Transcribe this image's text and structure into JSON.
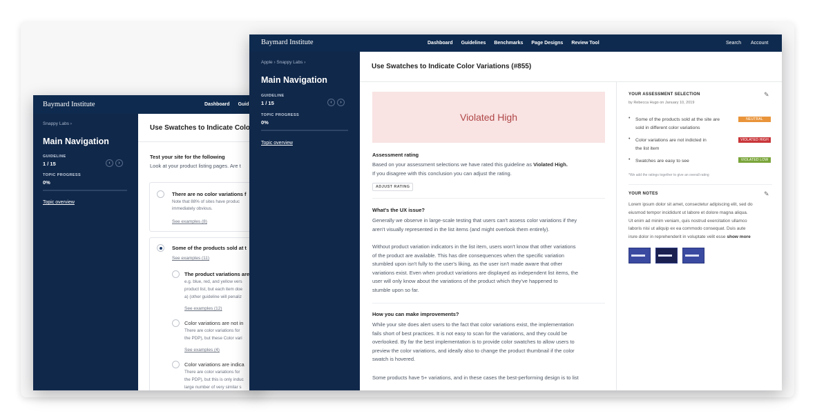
{
  "back": {
    "logo": "Baymard Institute",
    "nav": [
      "Dashboard",
      "Guid"
    ],
    "crumb": "Snappy Labs ›",
    "title": "Main Navigation",
    "guideline_label": "GUIDELINE",
    "guideline_value": "1 / 15",
    "progress_label": "TOPIC PROGRESS",
    "progress_value": "0%",
    "topic_link": "Topic overview",
    "header": "Use Swatches to Indicate Colo",
    "intro": "Test your site for the following",
    "intro_sub": "Look at your product listing pages. Are t",
    "option1": {
      "title": "There are no color variations f",
      "l1": "Note that 88% of sites have produc",
      "l2": "immediately obvious.",
      "link": "See examples (8)"
    },
    "option2": {
      "title": "Some of the products sold at t",
      "link": "See examples (11)"
    },
    "sub1": {
      "title": "The product variations are",
      "l1": "e.g. blue, red, and yellow vers",
      "l2": "product list, but each item doe",
      "l3": "a) (other guideline will penaliz",
      "link": "See examples (12)"
    },
    "sub2": {
      "title": "Color variations are not in",
      "l1": "There are color variations for",
      "l2": "the PDP), but these Color vari",
      "link": "See examples (4)"
    },
    "sub3": {
      "title": "Color variations are indica",
      "l1": "There are color variations for",
      "l2": "the PDP), but this is only induc",
      "l3": "large number of very similar s"
    }
  },
  "front": {
    "logo": "Baymard Institute",
    "nav": [
      "Dashboard",
      "Guidelines",
      "Benchmarks",
      "Page Designs",
      "Review Tool"
    ],
    "search": "Search",
    "account": "Account",
    "crumb1": "Apple",
    "crumb2": "Snappy Labs",
    "title": "Main Navigation",
    "guideline_label": "GUIDELINE",
    "guideline_value": "1 / 15",
    "progress_label": "TOPIC PROGRESS",
    "progress_value": "0%",
    "topic_link": "Topic overview",
    "header": "Use Swatches to Indicate Color Variations (#855)",
    "violated": "Violated High",
    "assessment_title": "Assessment rating",
    "assessment_l1": "Based on your assessment selections we have rated this guideline as",
    "assessment_bold": "Violated High.",
    "assessment_l2": "If you disagree with this conclusion you can adjust the rating.",
    "adjust_button": "ADJUST RATING",
    "ux_title": "What's the UX issue?",
    "ux_p1": [
      "Generally we observe in large-scale testing that users can't assess color variations if they",
      "aren't visually represented in the list items (and might overlook them entirely)."
    ],
    "ux_p2": [
      "Without product variation indicators in the list item, users won't know that other variations",
      "of the product are available. This has dire consequences when the specific variation",
      "stumbled upon isn't fully to the user's liking, as the user isn't made aware that other",
      "variations exist. Even when product variations are displayed as independent list items, the",
      "user will only know about the variations of the product which they've happened to",
      "stumble upon so far."
    ],
    "improve_title": "How you can make improvements?",
    "improve_p1": [
      "While your site does alert users to the fact that color variations exist, the implementation",
      "fails short of best practices. It is not easy to scan for the variations, and they could be",
      "overlooked. By far the best implementation is to provide color swatches to allow users to",
      "preview the color variations, and ideally also to change the product thumbnail if the color",
      "swatch is hovered."
    ],
    "improve_p2": "Some products have 5+ variations, and in these cases the best-performing design is to list",
    "selection_title": "YOUR ASSESSMENT SELECTION",
    "selection_by": "by Rebecca Hugo on January 10, 2019",
    "selections": [
      {
        "l1": "Some of the products sold at the site are",
        "l2": "sold in different color variations",
        "badge": "NEUTRAL",
        "color": "#e9943a"
      },
      {
        "l1": "Color variations are not indicted in",
        "l2": "the list item",
        "badge": "VIOLATED HIGH",
        "color": "#c9363a"
      },
      {
        "l1": "Swatches are easy to see",
        "l2": "",
        "badge": "VIOLATED LOW",
        "color": "#7aa53a"
      }
    ],
    "ratings_note": "*We add the ratings together to give an overall rating",
    "notes_title": "YOUR NOTES",
    "notes": [
      "Lorem ipsum dolor sit amet, consectetur adipiscing elit, sed do",
      "eiusmod tempor incididunt ut labore et dolore magna aliqua.",
      "Ut enim ad minim veniam, quis nostrud exercitation ullamco",
      "laboris nisi ut aliquip ex ea commodo consequat. Duis aute",
      "irure dolor in reprehenderit in voluptate velit esse"
    ],
    "show_more": "show more"
  }
}
